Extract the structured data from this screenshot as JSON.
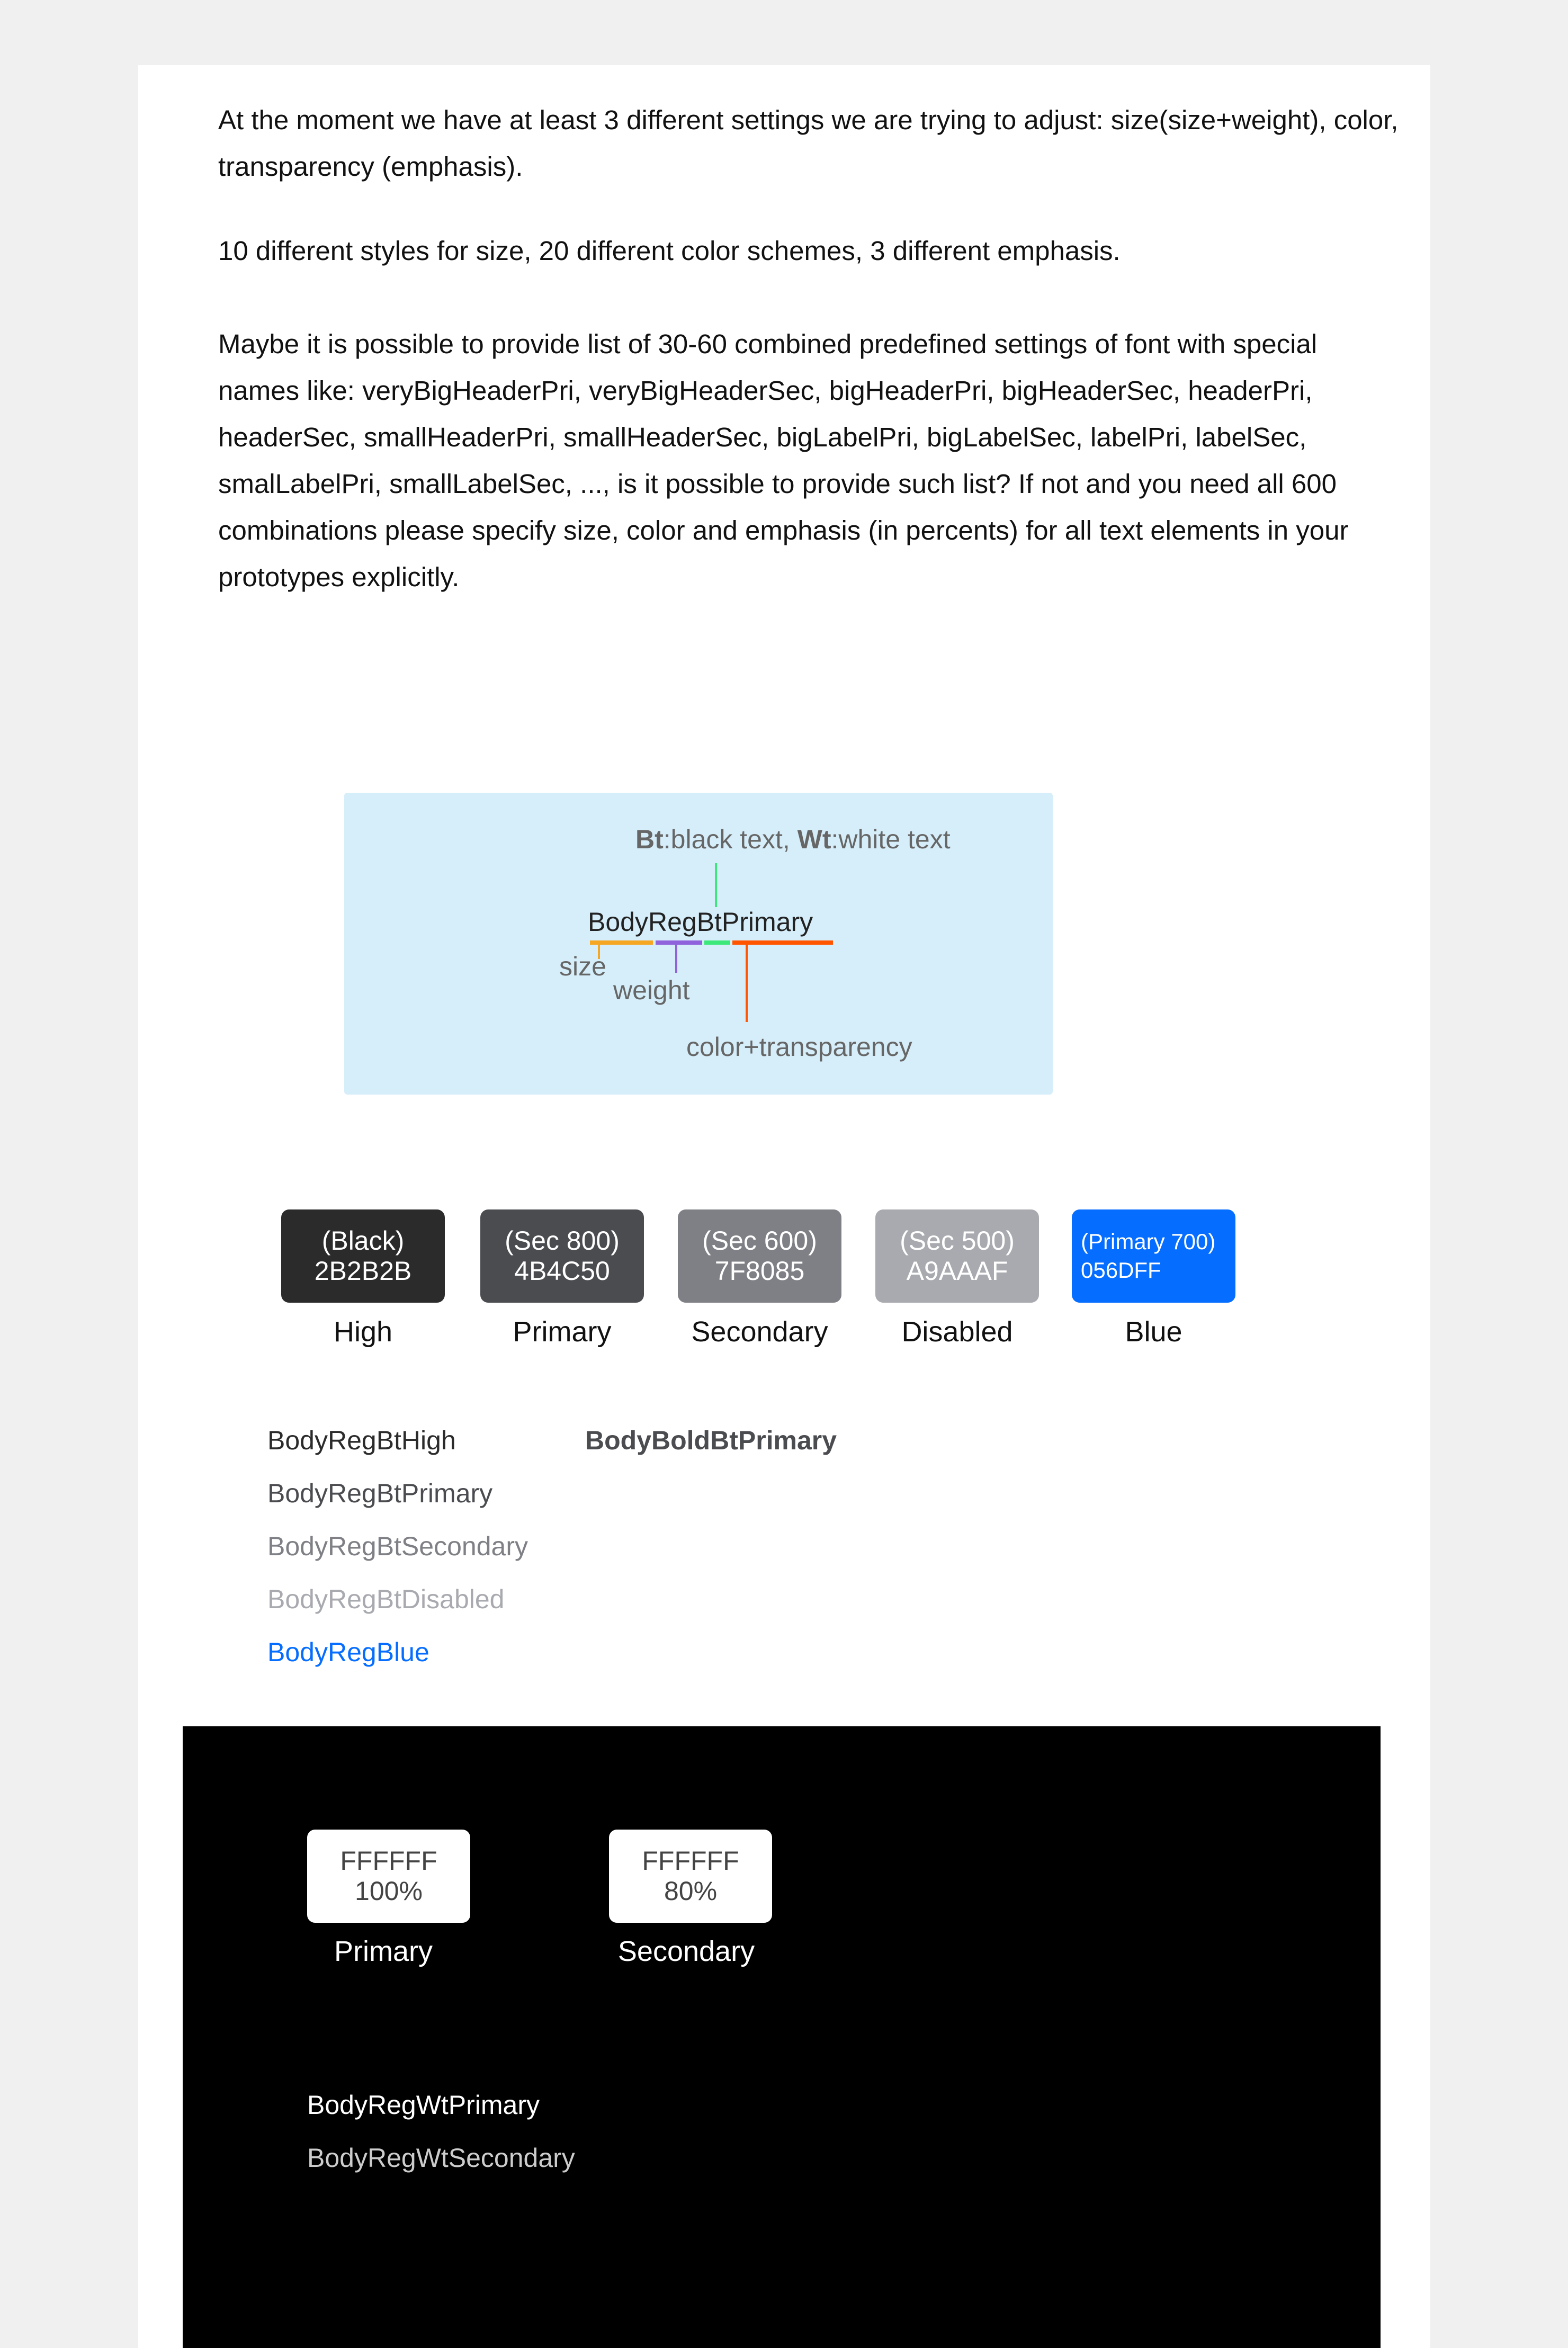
{
  "intro": {
    "paragraphs": [
      "At the moment we have at least 3 different settings we are trying to adjust: size(size+weight), color, transparency (emphasis).",
      "10 different styles for size, 20 different color schemes, 3 different emphasis.",
      "Maybe it is possible to provide list of 30-60 combined predefined settings of font with special names like: veryBigHeaderPri, veryBigHeaderSec, bigHeaderPri, bigHeaderSec, headerPri, headerSec, smallHeaderPri, smallHeaderSec, bigLabelPri, bigLabelSec, labelPri, labelSec, smalLabelPri, smallLabelSec, ..., is it possible to provide such list? If not and you need all 600 combinations please specify size, color and emphasis (in percents) for all text elements in your prototypes explicitly."
    ]
  },
  "diagram": {
    "legend": {
      "bt_abbr": "Bt",
      "bt_desc": ":black text, ",
      "wt_abbr": "Wt",
      "wt_desc": ":white text"
    },
    "example_name": "BodyRegBtPrimary",
    "labels": {
      "size": "size",
      "weight": "weight",
      "color_transparency": "color+transparency"
    },
    "segment_colors": {
      "size": "#F5A623",
      "weight": "#8E63DB",
      "text_color": "#3DE87A",
      "color_transparency": "#FF5500"
    },
    "background": "#D6EEFA"
  },
  "light_palette": {
    "swatches": [
      {
        "name": "(Black)",
        "hex": "2B2B2B",
        "label": "High",
        "color": "#2B2B2B"
      },
      {
        "name": "(Sec 800)",
        "hex": "4B4C50",
        "label": "Primary",
        "color": "#4B4C50"
      },
      {
        "name": "(Sec 600)",
        "hex": "7F8085",
        "label": "Secondary",
        "color": "#7F8085"
      },
      {
        "name": "(Sec 500)",
        "hex": "A9AAAF",
        "label": "Disabled",
        "color": "#A9AAAF"
      },
      {
        "name": "(Primary 700)",
        "hex": "056DFF",
        "label": "Blue",
        "color": "#056DFF"
      }
    ],
    "samples": [
      {
        "text": "BodyRegBtHigh",
        "color": "#2B2B2B"
      },
      {
        "text": "BodyRegBtPrimary",
        "color": "#4B4C50"
      },
      {
        "text": "BodyRegBtSecondary",
        "color": "#7F8085"
      },
      {
        "text": "BodyRegBtDisabled",
        "color": "#A9AAAF"
      },
      {
        "text": "BodyRegBlue",
        "color": "#056DFF"
      }
    ],
    "bold_sample": {
      "text": "BodyBoldBtPrimary",
      "color": "#4B4C50"
    }
  },
  "dark_palette": {
    "swatches": [
      {
        "hex": "FFFFFF",
        "opacity": "100%",
        "label": "Primary"
      },
      {
        "hex": "FFFFFF",
        "opacity": "80%",
        "label": "Secondary"
      }
    ],
    "samples": [
      {
        "text": "BodyRegWtPrimary",
        "color": "#FFFFFF"
      },
      {
        "text": "BodyRegWtSecondary",
        "color": "#CCCCCC"
      }
    ]
  }
}
